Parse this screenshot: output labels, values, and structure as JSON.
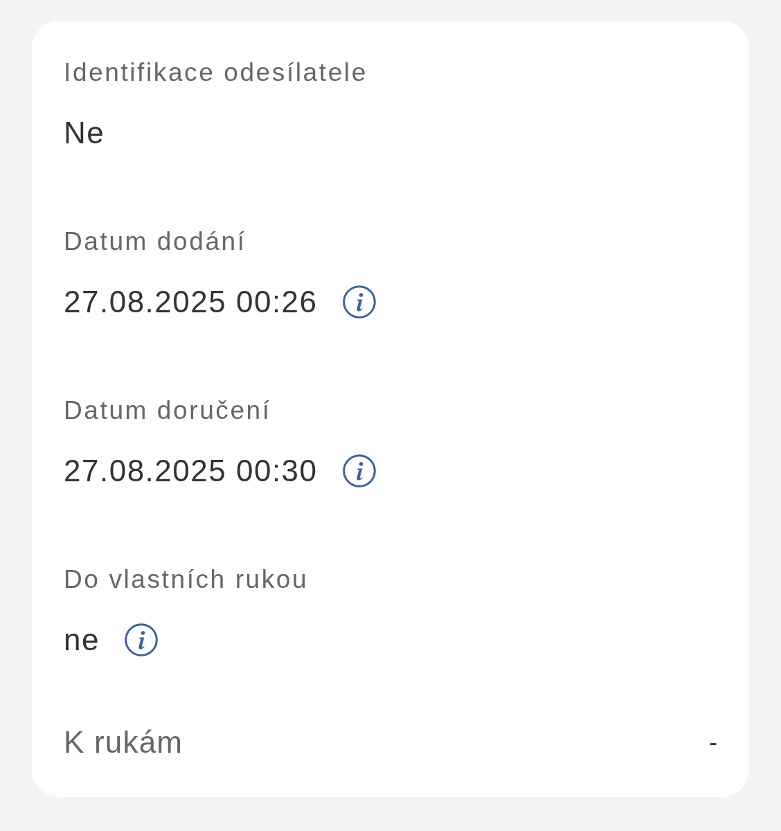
{
  "fields": [
    {
      "kind": "stacked",
      "label": "Identifikace odesílatele",
      "value": "Ne"
    },
    {
      "kind": "stacked",
      "label": "Datum dodání",
      "value": "27.08.2025 00:26",
      "info": true
    },
    {
      "kind": "stacked",
      "label": "Datum doručení",
      "value": "27.08.2025 00:30",
      "info": true
    },
    {
      "kind": "stacked",
      "label": "Do vlastních rukou",
      "value": "ne",
      "info": true
    },
    {
      "kind": "inline",
      "label": "K rukám",
      "value": "-"
    }
  ]
}
